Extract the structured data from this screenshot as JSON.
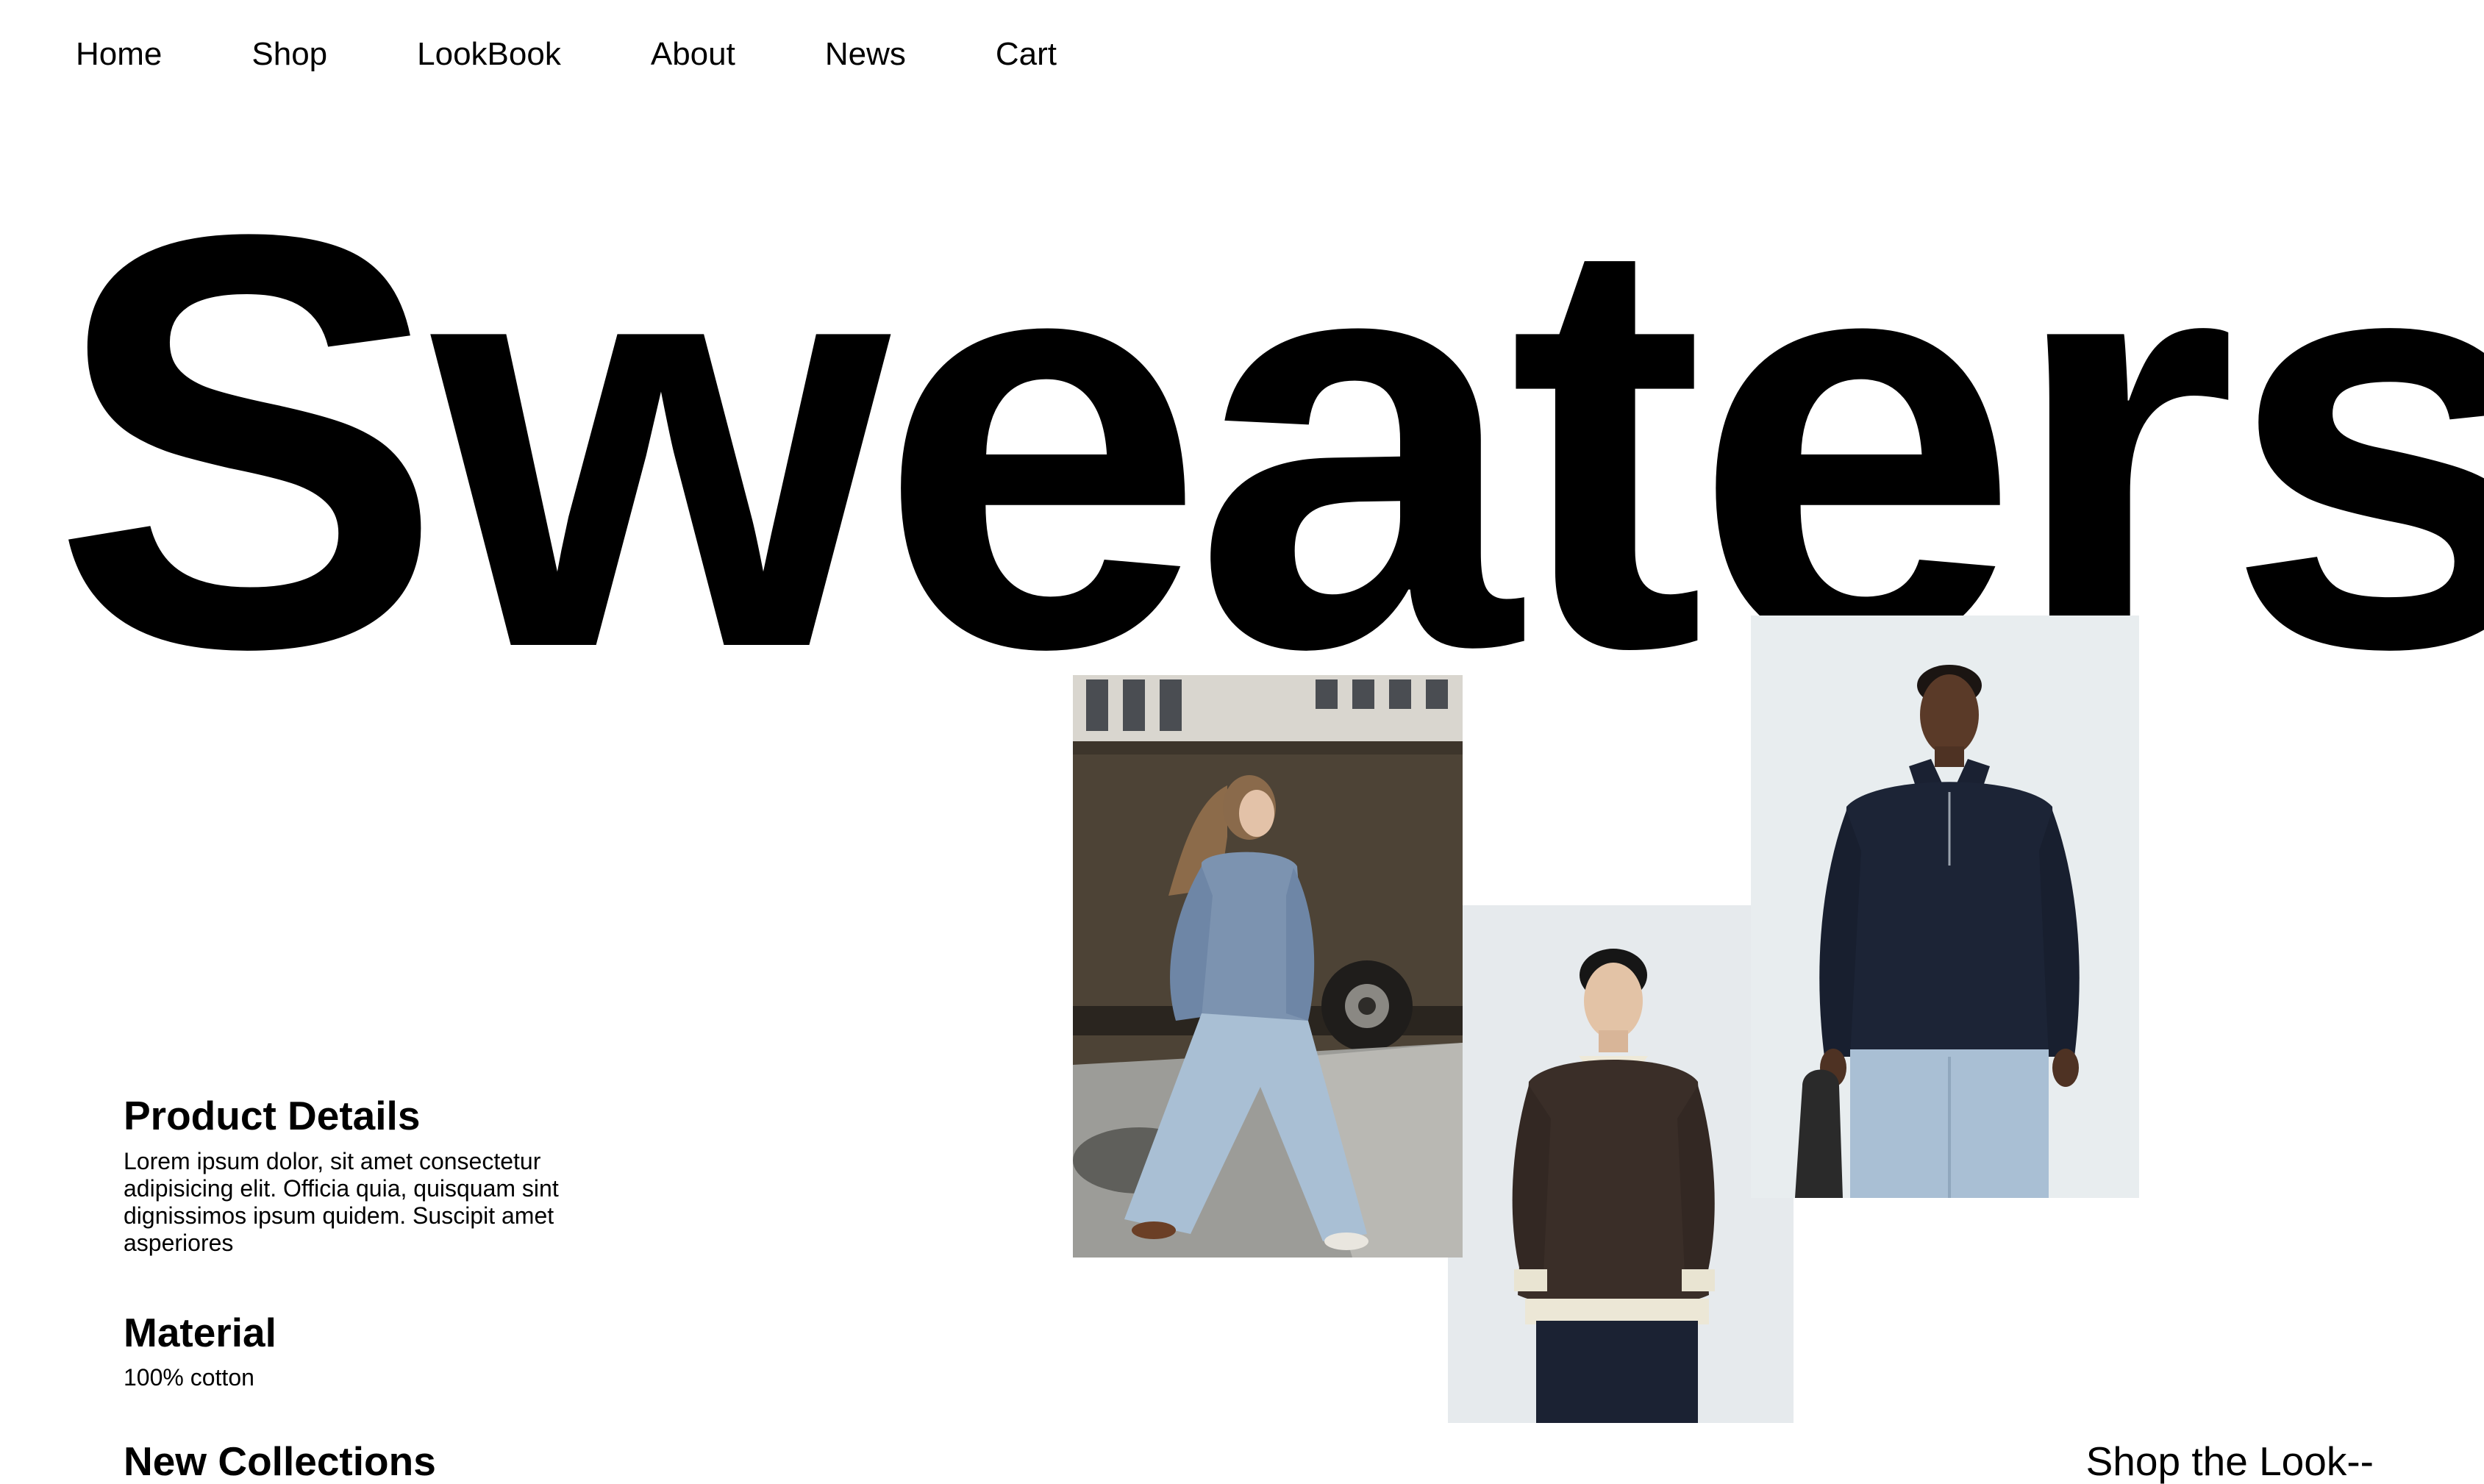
{
  "nav": {
    "items": [
      {
        "label": "Home"
      },
      {
        "label": "Shop"
      },
      {
        "label": "LookBook"
      },
      {
        "label": "About"
      },
      {
        "label": "News"
      },
      {
        "label": "Cart"
      }
    ]
  },
  "hero": {
    "title": "Sweaters"
  },
  "details": {
    "product_heading": "Product Details",
    "product_text": "Lorem ipsum dolor, sit amet consectetur adipisicing elit. Officia quia, quisquam sint dignissimos ipsum quidem. Suscipit amet asperiores",
    "material_heading": "Material",
    "material_value": "100% cotton",
    "collections_heading": "New Collections"
  },
  "cta": {
    "shop_look": "Shop the Look--"
  },
  "colors": {
    "background": "#ffffff",
    "text": "#000000",
    "sweater_blue": "#7c93b0",
    "sweater_brown": "#3a2e28",
    "sweater_navy": "#1c2436",
    "denim": "#a9bfd4",
    "studio_bg": "#e6eaed"
  }
}
